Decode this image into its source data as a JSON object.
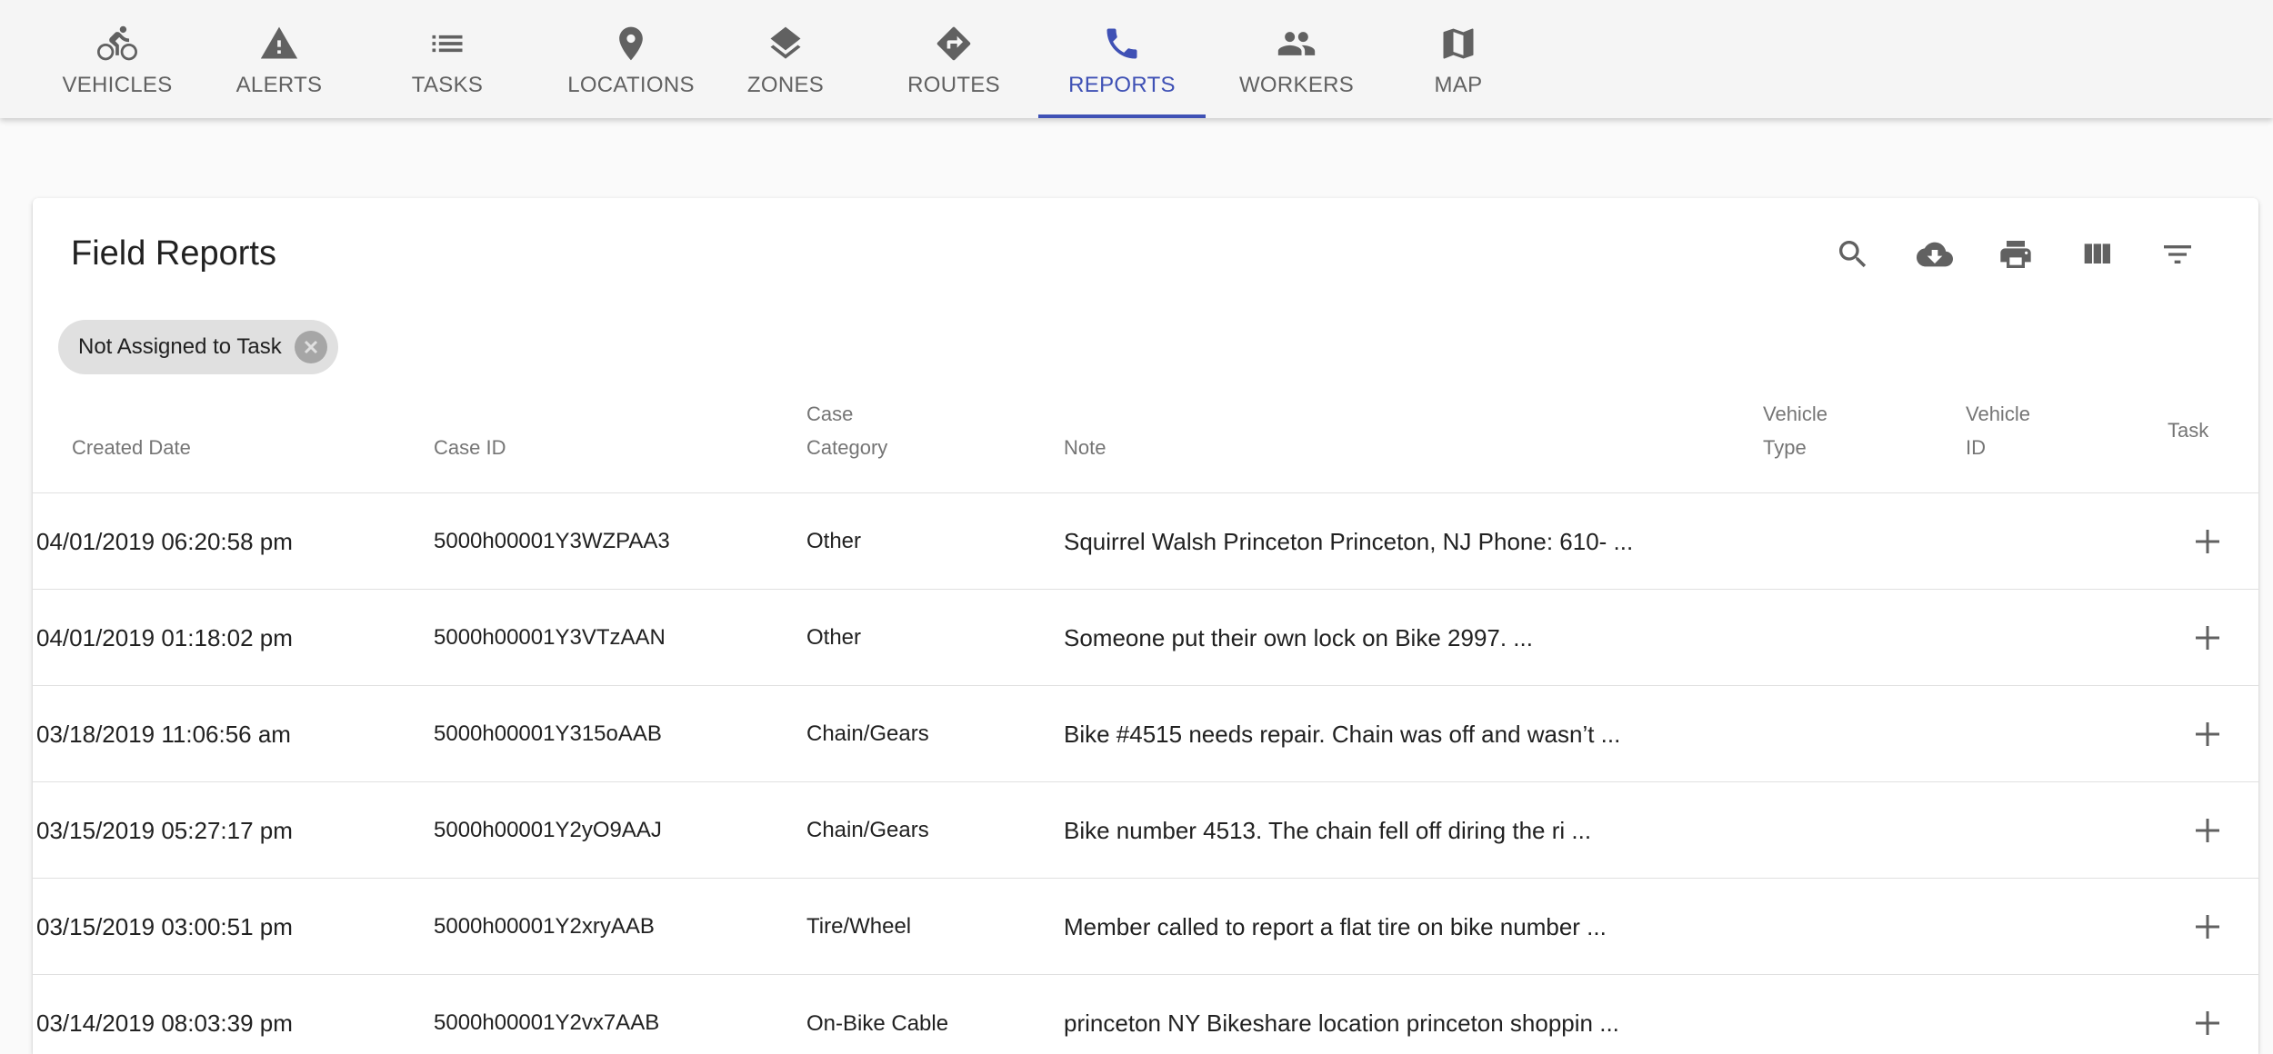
{
  "nav": {
    "items": [
      {
        "label": "VEHICLES",
        "icon": "bicycle-icon"
      },
      {
        "label": "ALERTS",
        "icon": "warning-icon"
      },
      {
        "label": "TASKS",
        "icon": "list-icon"
      },
      {
        "label": "LOCATIONS",
        "icon": "location-pin-icon"
      },
      {
        "label": "ZONES",
        "icon": "layers-icon"
      },
      {
        "label": "ROUTES",
        "icon": "directions-icon"
      },
      {
        "label": "REPORTS",
        "icon": "phone-icon",
        "active": true
      },
      {
        "label": "WORKERS",
        "icon": "people-icon"
      },
      {
        "label": "MAP",
        "icon": "map-icon"
      }
    ],
    "active_color": "#3f51b5"
  },
  "card": {
    "title": "Field Reports",
    "toolbar": [
      "search-icon",
      "download-icon",
      "print-icon",
      "columns-icon",
      "filter-icon"
    ]
  },
  "filter_chip": {
    "label": "Not Assigned to Task"
  },
  "table": {
    "columns": {
      "created_date": "Created Date",
      "case_id": "Case ID",
      "case_category_l1": "Case",
      "case_category_l2": "Category",
      "note": "Note",
      "vehicle_type_l1": "Vehicle",
      "vehicle_type_l2": "Type",
      "vehicle_id_l1": "Vehicle",
      "vehicle_id_l2": "ID",
      "task": "Task"
    },
    "rows": [
      {
        "date": "04/01/2019 06:20:58 pm",
        "case_id": "5000h00001Y3WZPAA3",
        "category": "Other",
        "note": "Squirrel Walsh Princeton Princeton, NJ Phone: 610- ..."
      },
      {
        "date": "04/01/2019 01:18:02 pm",
        "case_id": "5000h00001Y3VTzAAN",
        "category": "Other",
        "note": "Someone put their own lock on Bike 2997. ..."
      },
      {
        "date": "03/18/2019 11:06:56 am",
        "case_id": "5000h00001Y315oAAB",
        "category": "Chain/Gears",
        "note": "Bike #4515 needs repair. Chain was off and wasn’t ..."
      },
      {
        "date": "03/15/2019 05:27:17 pm",
        "case_id": "5000h00001Y2yO9AAJ",
        "category": "Chain/Gears",
        "note": "Bike number 4513. The chain fell off diring the ri ..."
      },
      {
        "date": "03/15/2019 03:00:51 pm",
        "case_id": "5000h00001Y2xryAAB",
        "category": "Tire/Wheel",
        "note": "Member called to report a flat tire on bike number ..."
      },
      {
        "date": "03/14/2019 08:03:39 pm",
        "case_id": "5000h00001Y2vx7AAB",
        "category": "On-Bike Cable",
        "note": "princeton NY Bikeshare location princeton shoppin ..."
      }
    ]
  }
}
